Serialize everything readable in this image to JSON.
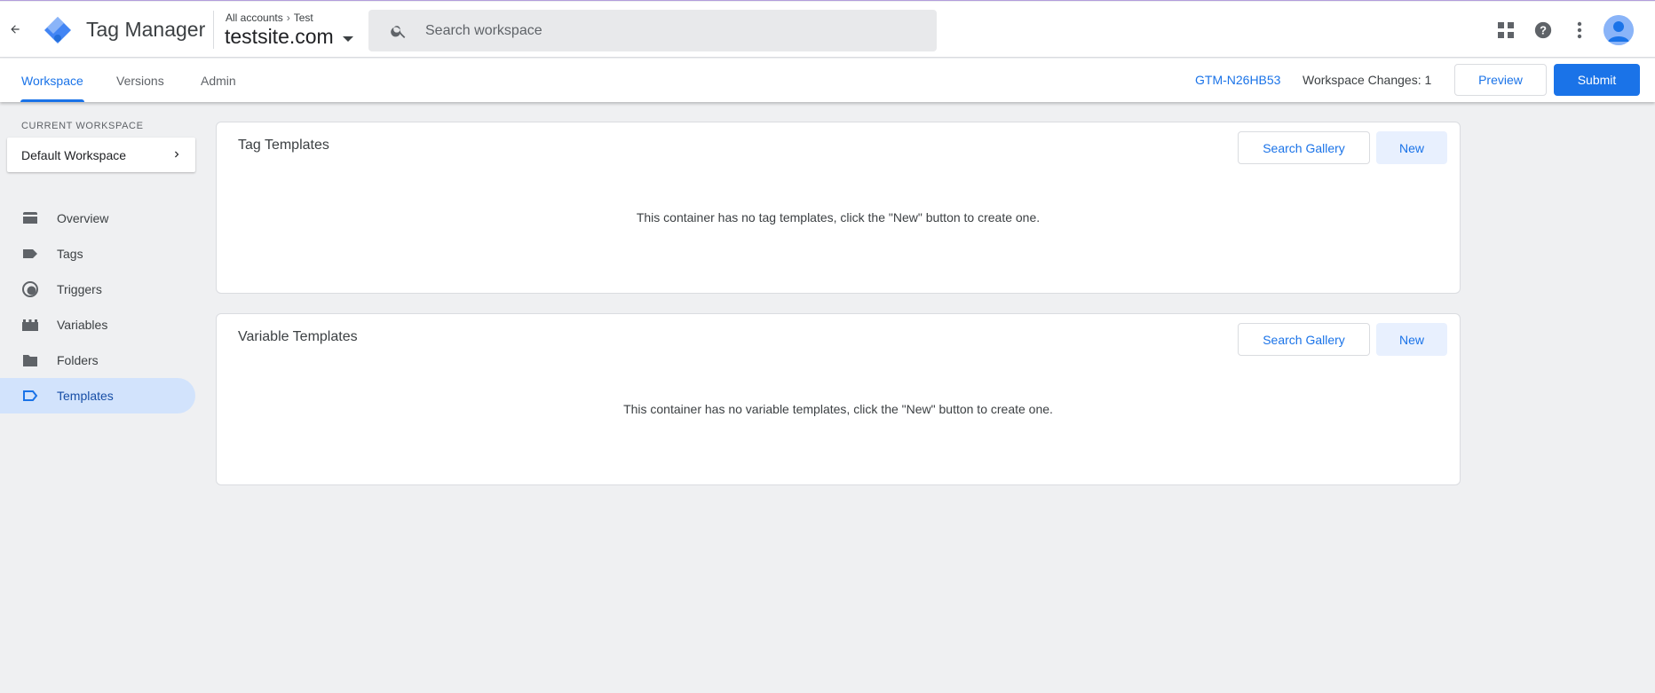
{
  "header": {
    "app_title": "Tag Manager",
    "breadcrumb": {
      "root": "All accounts",
      "account": "Test"
    },
    "container_name": "testsite.com",
    "search_placeholder": "Search workspace"
  },
  "subnav": {
    "tabs": [
      {
        "label": "Workspace",
        "active": true
      },
      {
        "label": "Versions",
        "active": false
      },
      {
        "label": "Admin",
        "active": false
      }
    ],
    "container_id": "GTM-N26HB53",
    "workspace_changes": "Workspace Changes: 1",
    "preview_label": "Preview",
    "submit_label": "Submit"
  },
  "sidebar": {
    "current_workspace_label": "CURRENT WORKSPACE",
    "workspace_name": "Default Workspace",
    "items": [
      {
        "label": "Overview",
        "icon": "overview-icon",
        "active": false
      },
      {
        "label": "Tags",
        "icon": "tag-icon",
        "active": false
      },
      {
        "label": "Triggers",
        "icon": "trigger-icon",
        "active": false
      },
      {
        "label": "Variables",
        "icon": "variables-icon",
        "active": false
      },
      {
        "label": "Folders",
        "icon": "folder-icon",
        "active": false
      },
      {
        "label": "Templates",
        "icon": "template-icon",
        "active": true
      }
    ]
  },
  "main": {
    "tag_templates": {
      "title": "Tag Templates",
      "search_gallery_label": "Search Gallery",
      "new_label": "New",
      "empty_message": "This container has no tag templates, click the \"New\" button to create one."
    },
    "variable_templates": {
      "title": "Variable Templates",
      "search_gallery_label": "Search Gallery",
      "new_label": "New",
      "empty_message": "This container has no variable templates, click the \"New\" button to create one."
    }
  },
  "colors": {
    "accent": "#1a73e8",
    "active_nav_bg": "#d2e3fc",
    "page_bg": "#eff0f2"
  }
}
